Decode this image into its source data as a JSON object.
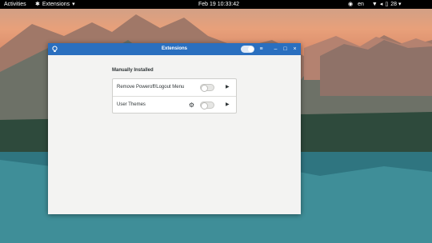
{
  "topbar": {
    "activities": "Activities",
    "app_menu": "Extensions",
    "clock": "Feb 19  10:33:42",
    "input_source": "en",
    "battery_percent": "28"
  },
  "window": {
    "title": "Extensions",
    "master_switch_on": true
  },
  "main": {
    "section_title": "Manually Installed",
    "extensions": [
      {
        "name": "Remove Poweroff/Logout Menu",
        "enabled": false,
        "has_settings": false
      },
      {
        "name": "User Themes",
        "enabled": false,
        "has_settings": true
      }
    ]
  },
  "colors": {
    "headerbar": "#2a6fbf",
    "topbar": "#000000",
    "window_bg": "#f3f3f2"
  },
  "icons": {
    "app_menu": "extensions-icon",
    "window_left": "lightbulb-icon",
    "menu": "hamburger-menu-icon",
    "minimize": "minimize-icon",
    "maximize": "maximize-icon",
    "close": "close-icon",
    "row_arrow": "chevron-right-icon",
    "settings": "gear-icon"
  }
}
